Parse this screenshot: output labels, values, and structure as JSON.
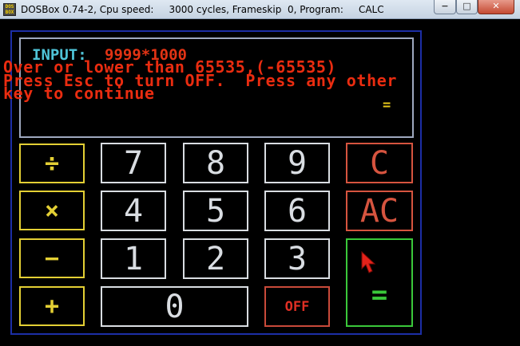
{
  "window": {
    "title": "DOSBox 0.74-2, Cpu speed:     3000 cycles, Frameskip  0, Program:     CALC",
    "app_icon_text": "DOS BOX",
    "minimize_label": "−",
    "maximize_label": "□",
    "close_label": "✕"
  },
  "display": {
    "input_label": "INPUT:",
    "input_value": "9999*1000",
    "error_lines": [
      "Over or lower than 65535,(-65535)",
      "Press Esc to turn OFF.  Press any other",
      "key to continue"
    ],
    "equals_indicator": "="
  },
  "keys": {
    "divide": "÷",
    "multiply": "×",
    "minus": "−",
    "plus": "+",
    "seven": "7",
    "eight": "8",
    "nine": "9",
    "four": "4",
    "five": "5",
    "six": "6",
    "one": "1",
    "two": "2",
    "three": "3",
    "zero": "0",
    "clear": "C",
    "all_clear": "AC",
    "equals": "=",
    "off": "OFF"
  },
  "colors": {
    "input_label": "#4fc4d8",
    "error_text": "#ea2c10",
    "operator_keys": "#e3cf34",
    "digit_keys": "#d9dde2",
    "clear_keys": "#d6543f",
    "equals_key": "#3ac83a",
    "calculator_border": "#1c2ea6"
  }
}
